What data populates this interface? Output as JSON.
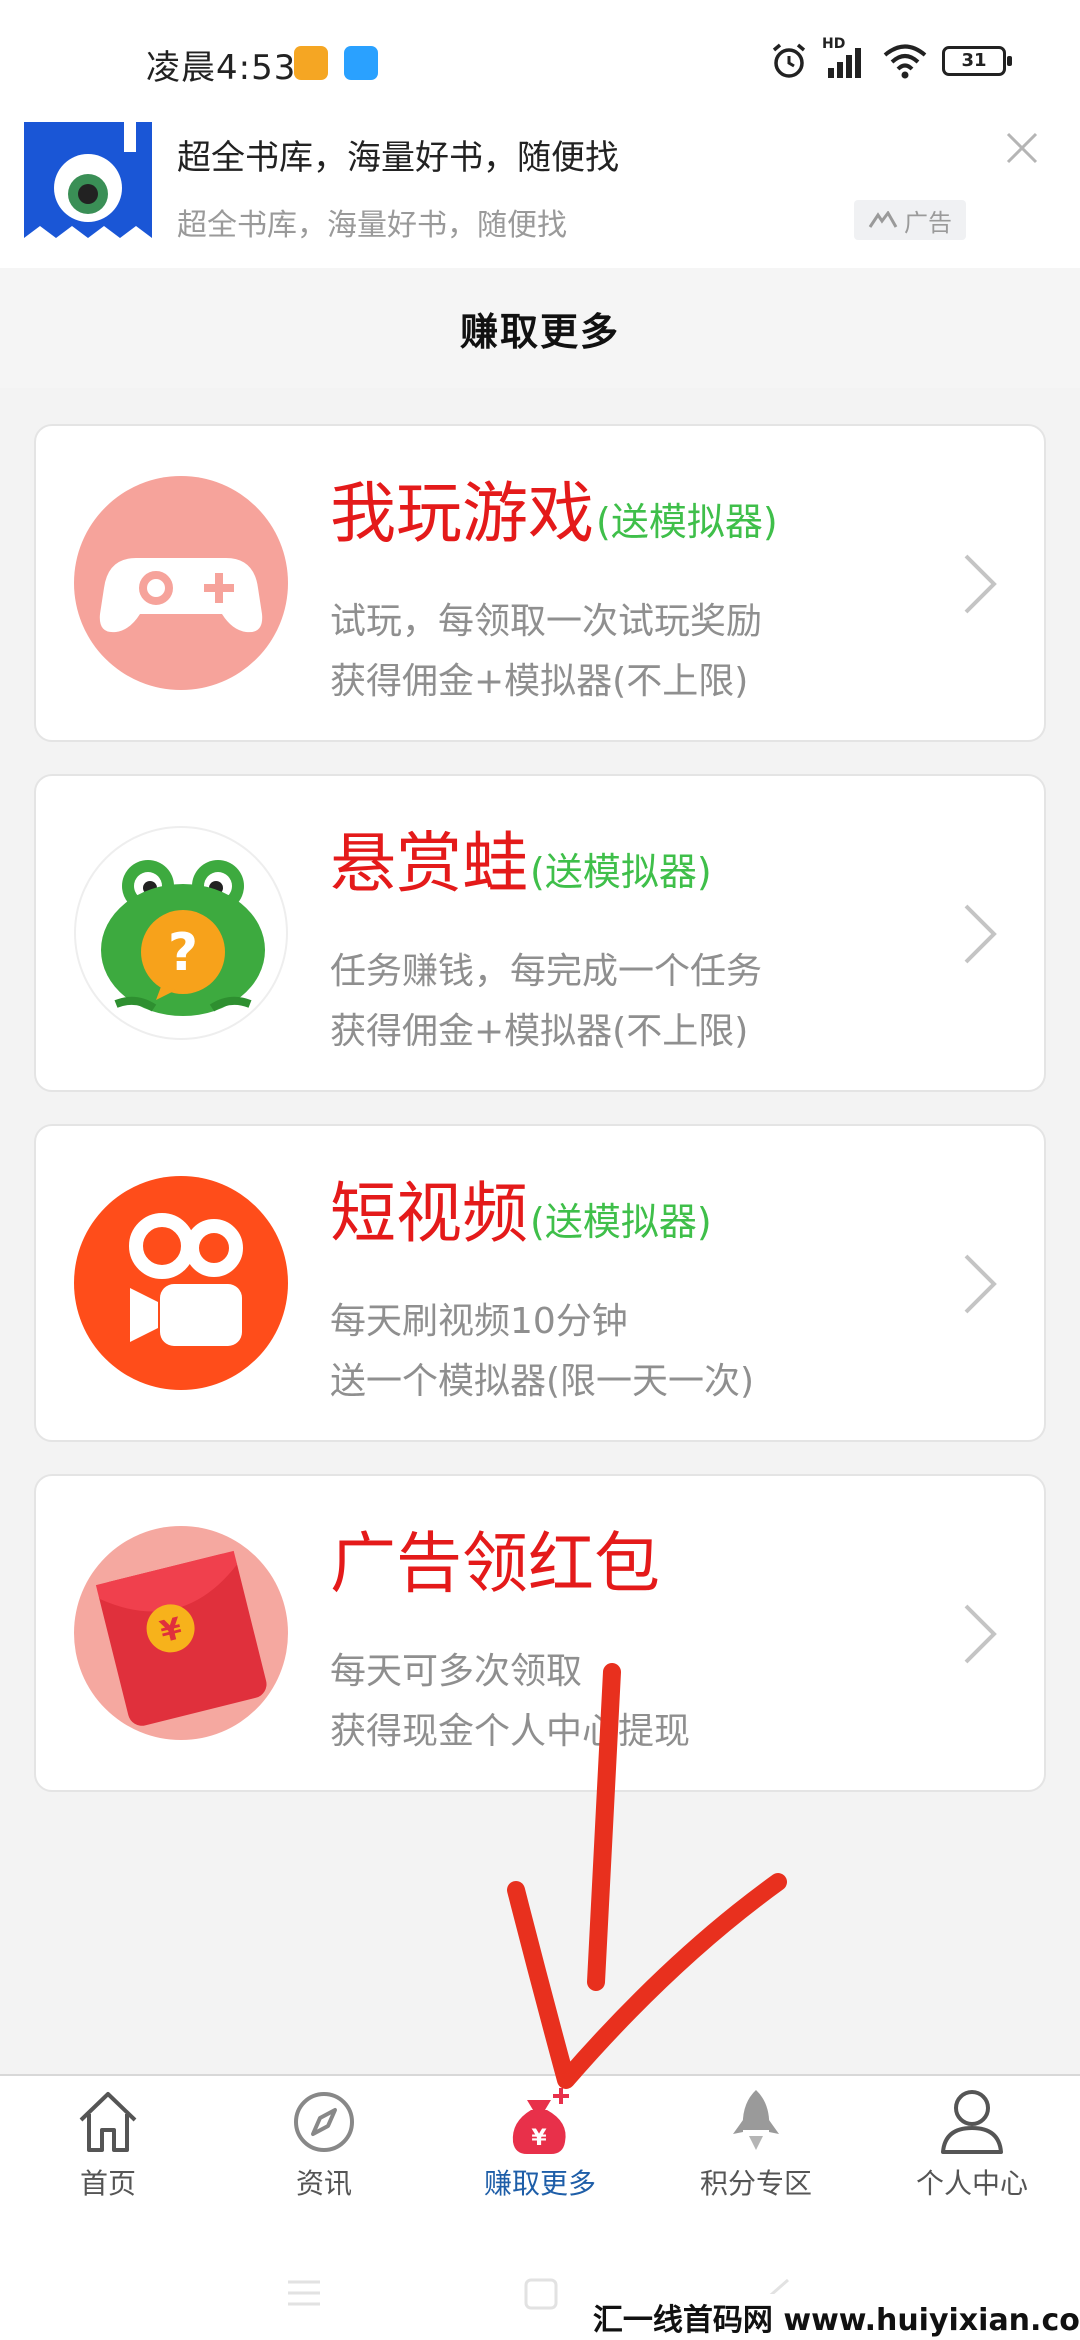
{
  "status_bar": {
    "time": "凌晨4:53",
    "battery": "31",
    "network": "HD"
  },
  "ad": {
    "title": "超全书库，海量好书，随便找",
    "subtitle": "超全书库，海量好书，随便找",
    "badge": "广告",
    "colors": {
      "logo_bg": "#1a56d6"
    }
  },
  "header": {
    "title": "赚取更多"
  },
  "cards": [
    {
      "title": "我玩游戏",
      "tag": "(送模拟器)",
      "line1": "试玩，每领取一次试玩奖励",
      "line2": "获得佣金+模拟器(不上限)",
      "icon": "gamepad-icon"
    },
    {
      "title": "悬赏蛙",
      "tag": "(送模拟器)",
      "line1": "任务赚钱，每完成一个任务",
      "line2": "获得佣金+模拟器(不上限)",
      "icon": "frog-icon"
    },
    {
      "title": "短视频",
      "tag": "(送模拟器)",
      "line1": "每天刷视频10分钟",
      "line2": "送一个模拟器(限一天一次)",
      "icon": "video-camera-icon"
    },
    {
      "title": "广告领红包",
      "tag": "",
      "line1": "每天可多次领取",
      "line2": "获得现金个人中心提现",
      "icon": "red-envelope-icon"
    }
  ],
  "nav": {
    "items": [
      {
        "label": "首页",
        "icon": "home-icon"
      },
      {
        "label": "资讯",
        "icon": "compass-icon"
      },
      {
        "label": "赚取更多",
        "icon": "money-bag-icon",
        "active": true
      },
      {
        "label": "积分专区",
        "icon": "rocket-icon"
      },
      {
        "label": "个人中心",
        "icon": "user-icon"
      }
    ],
    "active_color": "#1e5ea8"
  },
  "watermark": "汇一线首码网 www.huiyixian.com",
  "colors": {
    "title_red": "#e41a1a",
    "tag_green": "#3fbf4a",
    "annotation_red": "#e8301e"
  }
}
